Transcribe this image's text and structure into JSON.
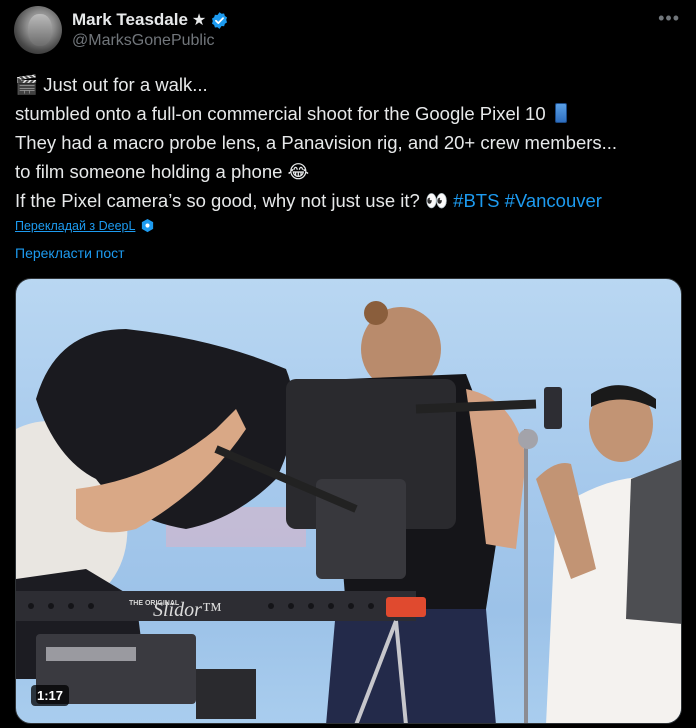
{
  "author": {
    "name": "Mark Teasdale",
    "star": "★",
    "handle": "@MarksGonePublic",
    "verified_icon": "verified-badge-icon",
    "more_label": "•••"
  },
  "tweet": {
    "line1_emoji": "🎬",
    "line1": "Just out for a walk...",
    "line2": "stumbled onto a full-on commercial shoot for the Google Pixel 10",
    "line3": "They had a macro probe lens, a Panavision rig, and 20+ crew members...",
    "line4_text": "to film someone holding a phone",
    "line4_emoji": "😂",
    "line5_text": "If the Pixel camera’s so good, why not just use it?",
    "line5_emoji": "👀",
    "hashtags": [
      "#BTS",
      "#Vancouver"
    ]
  },
  "translation": {
    "deepl_label": "Перекладай з DeepL",
    "translate_post": "Перекласти пост"
  },
  "media": {
    "duration": "1:17",
    "slider_brand_small": "THE ORIGINAL",
    "slider_brand": "Slidor™"
  },
  "colors": {
    "background": "#000000",
    "text": "#e7e9ea",
    "secondary": "#71767b",
    "link": "#1d9bf0"
  }
}
